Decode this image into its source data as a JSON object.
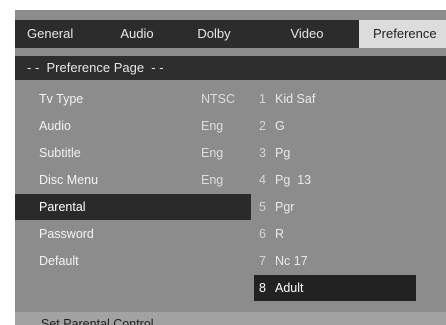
{
  "tabs": [
    {
      "label": "General",
      "active": false
    },
    {
      "label": "Audio",
      "active": false
    },
    {
      "label": "Dolby",
      "active": false
    },
    {
      "label": "Video",
      "active": false
    },
    {
      "label": "Preference",
      "active": true
    }
  ],
  "page_header": "- -  Preference Page  - -",
  "settings": [
    {
      "label": "Tv Type",
      "value": "NTSC"
    },
    {
      "label": "Audio",
      "value": "Eng"
    },
    {
      "label": "Subtitle",
      "value": "Eng"
    },
    {
      "label": "Disc Menu",
      "value": "Eng"
    },
    {
      "label": "Parental",
      "value": ""
    },
    {
      "label": "Password",
      "value": ""
    },
    {
      "label": "Default",
      "value": ""
    }
  ],
  "selected_setting": "Parental",
  "parental_options": [
    {
      "num": "1",
      "label": "Kid Saf"
    },
    {
      "num": "2",
      "label": "G"
    },
    {
      "num": "3",
      "label": "Pg"
    },
    {
      "num": "4",
      "label": "Pg  13"
    },
    {
      "num": "5",
      "label": "Pgr"
    },
    {
      "num": "6",
      "label": "R"
    },
    {
      "num": "7",
      "label": "Nc 17"
    },
    {
      "num": "8",
      "label": "Adult"
    }
  ],
  "selected_option": "Adult",
  "status_text": "Set  Parental  Control",
  "colors": {
    "panel_bg": "#8c8c8c",
    "bar_dark": "#2c2c2c",
    "active_tab": "#dcdcdc",
    "highlight": "#222222"
  }
}
